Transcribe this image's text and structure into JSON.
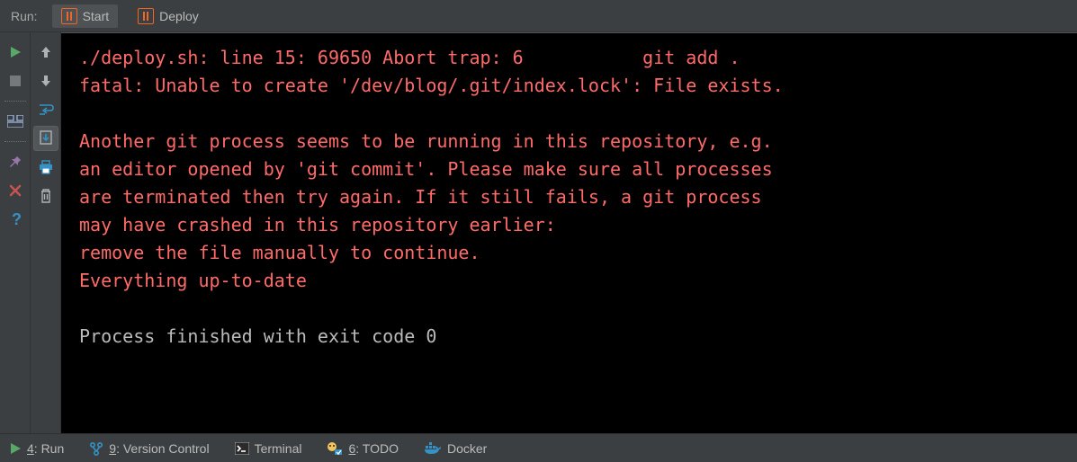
{
  "top": {
    "panel_label": "Run:",
    "tabs": [
      {
        "label": "Start",
        "active": true
      },
      {
        "label": "Deploy",
        "active": false
      }
    ]
  },
  "console": {
    "lines": [
      {
        "cls": "err",
        "text": "./deploy.sh: line 15: 69650 Abort trap: 6           git add ."
      },
      {
        "cls": "err",
        "text": "fatal: Unable to create '/dev/blog/.git/index.lock': File exists."
      },
      {
        "cls": "err",
        "text": ""
      },
      {
        "cls": "err",
        "text": "Another git process seems to be running in this repository, e.g."
      },
      {
        "cls": "err",
        "text": "an editor opened by 'git commit'. Please make sure all processes"
      },
      {
        "cls": "err",
        "text": "are terminated then try again. If it still fails, a git process"
      },
      {
        "cls": "err",
        "text": "may have crashed in this repository earlier:"
      },
      {
        "cls": "err",
        "text": "remove the file manually to continue."
      },
      {
        "cls": "err",
        "text": "Everything up-to-date"
      },
      {
        "cls": "norm",
        "text": ""
      },
      {
        "cls": "norm",
        "text": "Process finished with exit code 0"
      }
    ]
  },
  "bottom": {
    "items": [
      {
        "icon": "run",
        "mnemonic": "4",
        "label": ": Run",
        "active": true
      },
      {
        "icon": "vcs",
        "mnemonic": "9",
        "label": ": Version Control"
      },
      {
        "icon": "terminal",
        "mnemonic": "",
        "label": "Terminal"
      },
      {
        "icon": "todo",
        "mnemonic": "6",
        "label": ": TODO"
      },
      {
        "icon": "docker",
        "mnemonic": "",
        "label": "Docker"
      }
    ]
  },
  "gutter1": {
    "rerun": "rerun",
    "stop": "stop",
    "layout": "layout",
    "pin": "pin",
    "close": "close",
    "help": "help"
  },
  "gutter2": {
    "up": "up",
    "down": "down",
    "wrap": "soft-wrap",
    "scroll": "scroll-to-end",
    "print": "print",
    "clear": "clear-all"
  }
}
